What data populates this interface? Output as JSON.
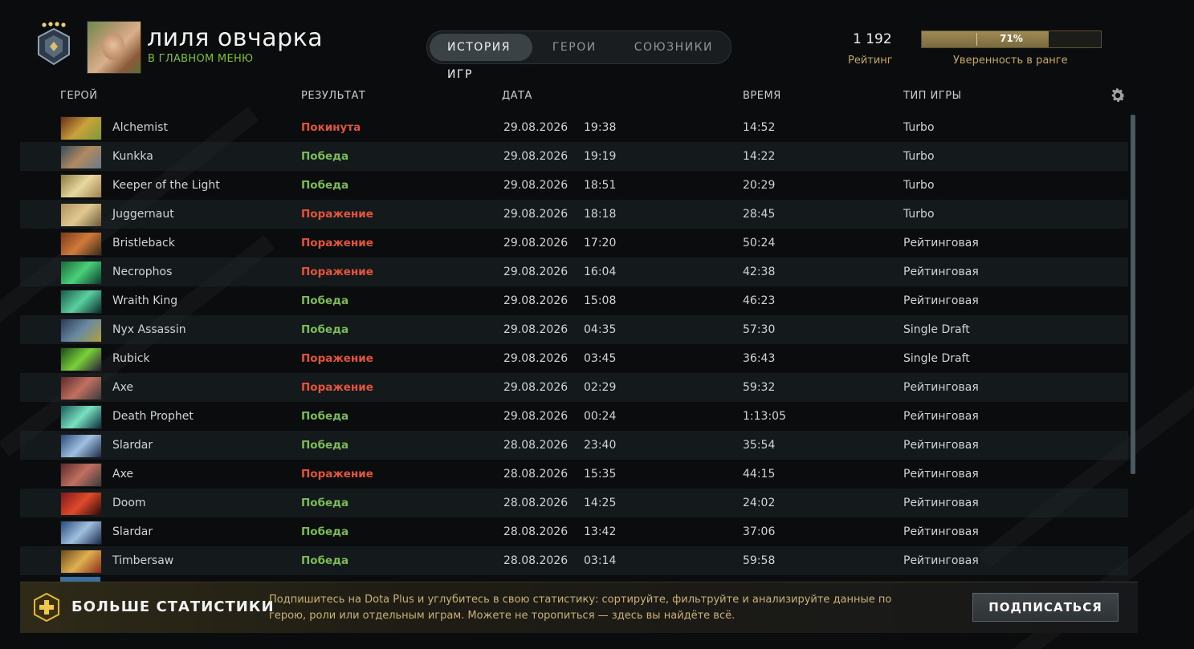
{
  "header": {
    "player_name": "лиля овчарка",
    "player_status": "В ГЛАВНОМ МЕНЮ",
    "tabs": [
      {
        "label": "ИСТОРИЯ ИГР",
        "active": true
      },
      {
        "label": "ГЕРОИ",
        "active": false
      },
      {
        "label": "СОЮЗНИКИ",
        "active": false
      }
    ],
    "rating_value": "1 192",
    "rating_label": "Рейтинг",
    "confidence_percent_text": "71%",
    "confidence_fraction": 0.71,
    "confidence_label": "Уверенность в ранге"
  },
  "table": {
    "columns": {
      "hero": "ГЕРОЙ",
      "result": "РЕЗУЛЬТАТ",
      "date": "ДАТА",
      "time": "ВРЕМЯ",
      "mode": "ТИП ИГРЫ"
    },
    "rows": [
      {
        "hero": "Alchemist",
        "result": "Покинута",
        "outcome": "left",
        "date": "29.08.2026",
        "clock": "19:38",
        "duration": "14:52",
        "mode": "Turbo",
        "pic": [
          "#6b2f1a",
          "#c9a23a",
          "#7a9a3a"
        ]
      },
      {
        "hero": "Kunkka",
        "result": "Победа",
        "outcome": "win",
        "date": "29.08.2026",
        "clock": "19:19",
        "duration": "14:22",
        "mode": "Turbo",
        "pic": [
          "#3a4a5a",
          "#b08a60",
          "#6a7a8a"
        ]
      },
      {
        "hero": "Keeper of the Light",
        "result": "Победа",
        "outcome": "win",
        "date": "29.08.2026",
        "clock": "18:51",
        "duration": "20:29",
        "mode": "Turbo",
        "pic": [
          "#8a7a40",
          "#e8d8a0",
          "#a08050"
        ]
      },
      {
        "hero": "Juggernaut",
        "result": "Поражение",
        "outcome": "loss",
        "date": "29.08.2026",
        "clock": "18:18",
        "duration": "28:45",
        "mode": "Turbo",
        "pic": [
          "#b09060",
          "#e0c890",
          "#6a5a3a"
        ]
      },
      {
        "hero": "Bristleback",
        "result": "Поражение",
        "outcome": "loss",
        "date": "29.08.2026",
        "clock": "17:20",
        "duration": "50:24",
        "mode": "Рейтинговая",
        "pic": [
          "#7a3a1a",
          "#d07a3a",
          "#3a2a1a"
        ]
      },
      {
        "hero": "Necrophos",
        "result": "Поражение",
        "outcome": "loss",
        "date": "29.08.2026",
        "clock": "16:04",
        "duration": "42:38",
        "mode": "Рейтинговая",
        "pic": [
          "#1a6a3a",
          "#4ad07a",
          "#0a3a2a"
        ]
      },
      {
        "hero": "Wraith King",
        "result": "Победа",
        "outcome": "win",
        "date": "29.08.2026",
        "clock": "15:08",
        "duration": "46:23",
        "mode": "Рейтинговая",
        "pic": [
          "#1a5a4a",
          "#5ad0a0",
          "#0a2a2a"
        ]
      },
      {
        "hero": "Nyx Assassin",
        "result": "Победа",
        "outcome": "win",
        "date": "29.08.2026",
        "clock": "04:35",
        "duration": "57:30",
        "mode": "Single Draft",
        "pic": [
          "#2a3a5a",
          "#6a8aa0",
          "#b0a040"
        ]
      },
      {
        "hero": "Rubick",
        "result": "Поражение",
        "outcome": "loss",
        "date": "29.08.2026",
        "clock": "03:45",
        "duration": "36:43",
        "mode": "Single Draft",
        "pic": [
          "#1a4a1a",
          "#7ad03a",
          "#2a1a3a"
        ]
      },
      {
        "hero": "Axe",
        "result": "Поражение",
        "outcome": "loss",
        "date": "29.08.2026",
        "clock": "02:29",
        "duration": "59:32",
        "mode": "Рейтинговая",
        "pic": [
          "#5a2a2a",
          "#c07060",
          "#3a3a3a"
        ]
      },
      {
        "hero": "Death Prophet",
        "result": "Победа",
        "outcome": "win",
        "date": "29.08.2026",
        "clock": "00:24",
        "duration": "1:13:05",
        "mode": "Рейтинговая",
        "pic": [
          "#1a5a5a",
          "#7ae0c0",
          "#0a2a3a"
        ]
      },
      {
        "hero": "Slardar",
        "result": "Победа",
        "outcome": "win",
        "date": "28.08.2026",
        "clock": "23:40",
        "duration": "35:54",
        "mode": "Рейтинговая",
        "pic": [
          "#2a4a7a",
          "#a0c0e0",
          "#1a2a4a"
        ]
      },
      {
        "hero": "Axe",
        "result": "Поражение",
        "outcome": "loss",
        "date": "28.08.2026",
        "clock": "15:35",
        "duration": "44:15",
        "mode": "Рейтинговая",
        "pic": [
          "#5a2a2a",
          "#c07060",
          "#3a3a3a"
        ]
      },
      {
        "hero": "Doom",
        "result": "Победа",
        "outcome": "win",
        "date": "28.08.2026",
        "clock": "14:25",
        "duration": "24:02",
        "mode": "Рейтинговая",
        "pic": [
          "#7a1a1a",
          "#e04a2a",
          "#2a0a0a"
        ]
      },
      {
        "hero": "Slardar",
        "result": "Победа",
        "outcome": "win",
        "date": "28.08.2026",
        "clock": "13:42",
        "duration": "37:06",
        "mode": "Рейтинговая",
        "pic": [
          "#2a4a7a",
          "#a0c0e0",
          "#1a2a4a"
        ]
      },
      {
        "hero": "Timbersaw",
        "result": "Победа",
        "outcome": "win",
        "date": "28.08.2026",
        "clock": "03:14",
        "duration": "59:58",
        "mode": "Рейтинговая",
        "pic": [
          "#6a4a1a",
          "#e0b050",
          "#8a2a1a"
        ]
      }
    ]
  },
  "promo": {
    "title": "БОЛЬШЕ СТАТИСТИКИ",
    "text": "Подпишитесь на Dota Plus и углубитесь в свою статистику: сортируйте, фильтруйте и анализируйте данные по герою, роли или отдельным играм. Можете не торопиться — здесь вы найдёте всё.",
    "button": "ПОДПИСАТЬСЯ"
  },
  "icons": {
    "medal": "rank-medal-icon",
    "settings": "gear-icon",
    "dota_plus": "dota-plus-icon"
  },
  "colors": {
    "win": "#7eb95a",
    "loss": "#e0553d",
    "status_green": "#7fbf3e",
    "gold": "#c3a86a"
  }
}
